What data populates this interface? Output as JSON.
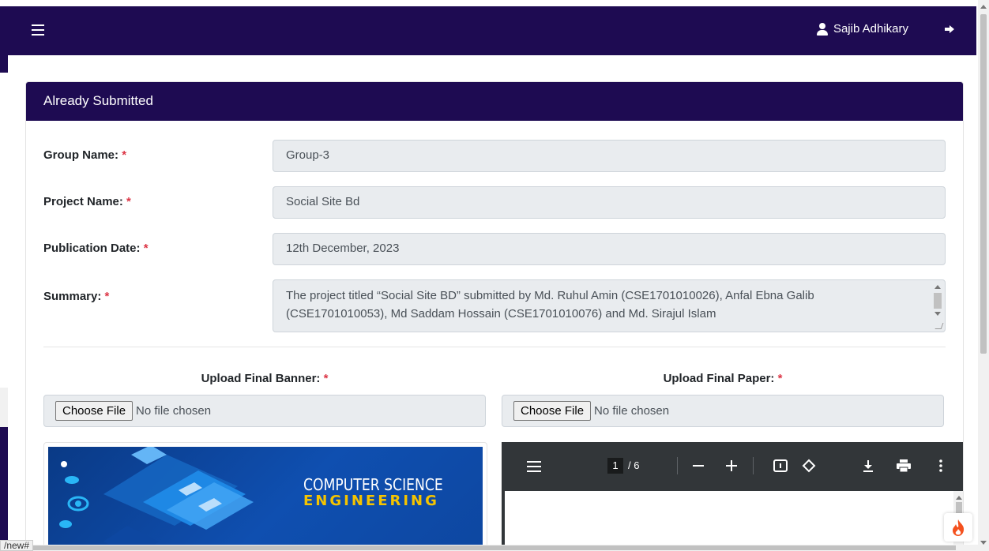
{
  "topbar": {
    "user_name": "Sajib Adhikary"
  },
  "card": {
    "title": "Already Submitted"
  },
  "form": {
    "group_name": {
      "label": "Group Name:",
      "value": "Group-3"
    },
    "project_name": {
      "label": "Project Name:",
      "value": "Social Site Bd"
    },
    "publication_date": {
      "label": "Publication Date:",
      "value": "12th December, 2023"
    },
    "summary": {
      "label": "Summary:",
      "value": "The project titled “Social Site BD” submitted by Md. Ruhul Amin (CSE1701010026), Anfal Ebna Galib (CSE1701010053), Md Saddam Hossain (CSE1701010076) and Md. Sirajul Islam"
    },
    "required_mark": "*"
  },
  "upload": {
    "banner": {
      "label": "Upload Final Banner:",
      "button": "Choose File",
      "status": "No file chosen"
    },
    "paper": {
      "label": "Upload Final Paper:",
      "button": "Choose File",
      "status": "No file chosen"
    }
  },
  "banner_image": {
    "line1": "COMPUTER SCIENCE",
    "line2": "ENGINEERING"
  },
  "pdf_viewer": {
    "current_page": "1",
    "page_total": "/ 6"
  },
  "status_bar": {
    "url_fragment": "/new#"
  },
  "colors": {
    "navbar": "#1e0b52",
    "required": "#dc3545",
    "field_bg": "#e9ecef"
  }
}
